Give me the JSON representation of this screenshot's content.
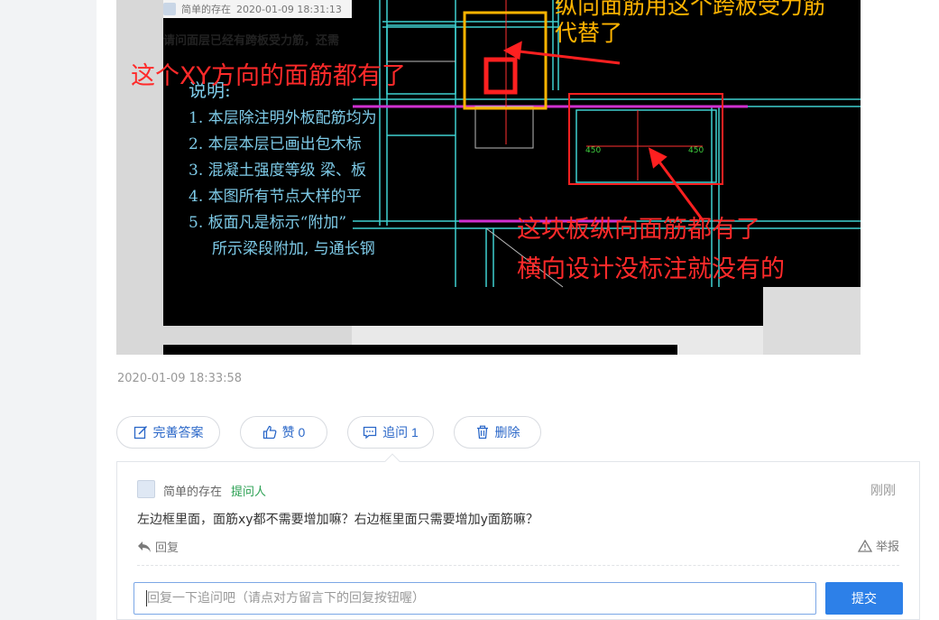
{
  "screenshot": {
    "meta_user": "简单的存在",
    "meta_time": "2020-01-09 18:31:13",
    "question_line": "请问面层已经有跨板受力筋，还需",
    "notes": {
      "title": "说明:",
      "items": [
        "1. 本层除注明外板配筋均为",
        "2. 本层本层已画出包木标",
        "3. 混凝土强度等级 梁、板",
        "4. 本图所有节点大样的平",
        "5. 板面凡是标示“附加”",
        "所示梁段附加, 与通长钢"
      ]
    },
    "annotations": {
      "xy": "这个XY方向的面筋都有了",
      "yellow_line1": "纵向面筋用这个跨板受力筋",
      "yellow_line2": "代替了",
      "red_line1": "这块板纵向面筋都有了",
      "red_line2": "横向设计没标注就没有的"
    },
    "dim_left": "450",
    "dim_right": "450"
  },
  "timestamp": "2020-01-09 18:33:58",
  "actions": {
    "improve": "完善答案",
    "like": "赞 0",
    "followup": "追问  1",
    "delete": "删除"
  },
  "followup": {
    "user": "简单的存在",
    "role": "提问人",
    "time": "刚刚",
    "question": "左边框里面，面筋xy都不需要增加嘛？右边框里面只需要增加y面筋嘛？",
    "reply_label": "回复",
    "report_label": "举报",
    "input_placeholder": "回复一下追问吧（请点对方留言下的回复按钮喔）",
    "submit_label": "提交"
  },
  "colors": {
    "accent": "#2d80e8",
    "role_green": "#2aa052",
    "annotation_red": "#ff2a2a",
    "annotation_yellow": "#ffb400"
  }
}
